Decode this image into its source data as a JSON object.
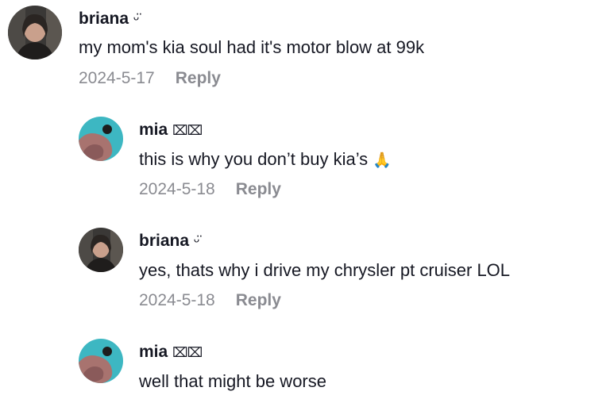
{
  "comments": [
    {
      "username": "briana",
      "username_suffix": "ᵕ̈",
      "text": "my mom's kia soul had it's motor blow at 99k",
      "date": "2024-5-17",
      "reply_label": "Reply",
      "avatar": "woman-portrait-avatar"
    },
    {
      "username": "mia",
      "username_suffix": "⌧⌧",
      "text": "this is why you don’t buy kia’s",
      "emoji": "🙏",
      "date": "2024-5-18",
      "reply_label": "Reply",
      "avatar": "teal-photo-avatar"
    },
    {
      "username": "briana",
      "username_suffix": "ᵕ̈",
      "text": "yes, thats why i drive my chrysler pt cruiser LOL",
      "date": "2024-5-18",
      "reply_label": "Reply",
      "avatar": "woman-portrait-avatar"
    },
    {
      "username": "mia",
      "username_suffix": "⌧⌧",
      "text": "well that might be worse",
      "avatar": "teal-photo-avatar"
    }
  ],
  "colors": {
    "text": "#161823",
    "muted": "#8a8b91",
    "background": "#ffffff"
  }
}
